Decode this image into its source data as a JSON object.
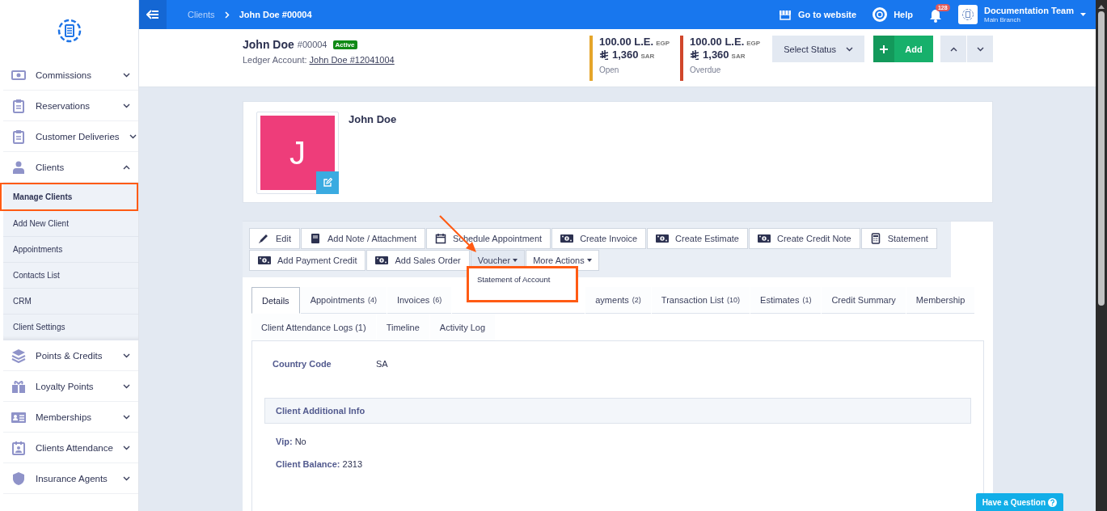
{
  "topbar": {
    "breadcrumb": [
      {
        "label": "Clients",
        "current": false
      },
      {
        "label": "John Doe #00004",
        "current": true
      }
    ],
    "website": "Go to website",
    "help": "Help",
    "notifications": "128",
    "user": {
      "name": "Documentation Team",
      "branch": "Main Branch"
    }
  },
  "sidebar": {
    "items": [
      {
        "label": "Commissions",
        "expanded": false
      },
      {
        "label": "Reservations",
        "expanded": false
      },
      {
        "label": "Customer Deliveries",
        "expanded": false
      },
      {
        "label": "Clients",
        "expanded": true,
        "children": [
          {
            "label": "Manage Clients",
            "selected": true,
            "highlighted": true
          },
          {
            "label": "Add New Client",
            "selected": false,
            "highlighted": false
          },
          {
            "label": "Appointments",
            "selected": false,
            "highlighted": false
          },
          {
            "label": "Contacts List",
            "selected": false,
            "highlighted": false
          },
          {
            "label": "CRM",
            "selected": false,
            "highlighted": false
          },
          {
            "label": "Client Settings",
            "selected": false,
            "highlighted": false
          }
        ]
      },
      {
        "label": "Points & Credits",
        "expanded": false
      },
      {
        "label": "Loyalty Points",
        "expanded": false
      },
      {
        "label": "Memberships",
        "expanded": false
      },
      {
        "label": "Clients Attendance",
        "expanded": false
      },
      {
        "label": "Insurance Agents",
        "expanded": false
      }
    ]
  },
  "client": {
    "name": "John Doe",
    "number": "#00004",
    "status": "Active",
    "ledger_label": "Ledger Account:",
    "ledger_link": "John Doe #12041004",
    "balances": [
      {
        "amount": "100.00 L.E.",
        "currency": "EGP",
        "amount_2": "1,360",
        "currency_2": "SAR",
        "label": "Open",
        "color": "#e5a52a"
      },
      {
        "amount": "100.00 L.E.",
        "currency": "EGP",
        "amount_2": "1,360",
        "currency_2": "SAR",
        "label": "Overdue",
        "color": "#d0462b"
      }
    ],
    "status_select": "Select Status",
    "add_button": "Add"
  },
  "profile": {
    "initial": "J",
    "name": "John Doe"
  },
  "actions": [
    {
      "label": "Edit",
      "kind": "button"
    },
    {
      "label": "Add Note / Attachment",
      "kind": "button"
    },
    {
      "label": "Schedule Appointment",
      "kind": "button"
    },
    {
      "label": "Create Invoice",
      "kind": "button"
    },
    {
      "label": "Create Estimate",
      "kind": "button"
    },
    {
      "label": "Create Credit Note",
      "kind": "button"
    },
    {
      "label": "Statement",
      "kind": "button"
    },
    {
      "label": "Add Payment Credit",
      "kind": "button"
    },
    {
      "label": "Add Sales Order",
      "kind": "button"
    },
    {
      "label": "Voucher",
      "kind": "dropdown",
      "expanded": true,
      "menu": [
        {
          "label": "Statement of Account",
          "highlighted": true
        }
      ]
    },
    {
      "label": "More Actions",
      "kind": "dropdown",
      "expanded": false
    }
  ],
  "tabs": [
    {
      "label": "Details",
      "selected": true
    },
    {
      "label": "Appointments",
      "count": "(4)",
      "selected": false
    },
    {
      "label": "Invoices",
      "count": "(6)",
      "selected": false
    },
    {
      "kind": "covered"
    },
    {
      "label": "ayments",
      "count": "(2)",
      "selected": false
    },
    {
      "label": "Transaction List",
      "count": "(10)",
      "selected": false
    },
    {
      "label": "Estimates",
      "count": "(1)",
      "selected": false
    },
    {
      "label": "Credit Summary",
      "selected": false
    },
    {
      "label": "Membership",
      "selected": false
    },
    {
      "label": "Client Attendance Logs (1)",
      "selected": false
    },
    {
      "label": "Timeline",
      "selected": false
    },
    {
      "label": "Activity Log",
      "selected": false
    }
  ],
  "details": {
    "fields": [
      {
        "label": "Country Code",
        "value": "SA"
      }
    ],
    "section": "Client Additional Info",
    "info": [
      {
        "label": "Vip:",
        "value": "No"
      },
      {
        "label": "Client Balance:",
        "value": "2313"
      }
    ]
  },
  "help_button": "Have a Question"
}
